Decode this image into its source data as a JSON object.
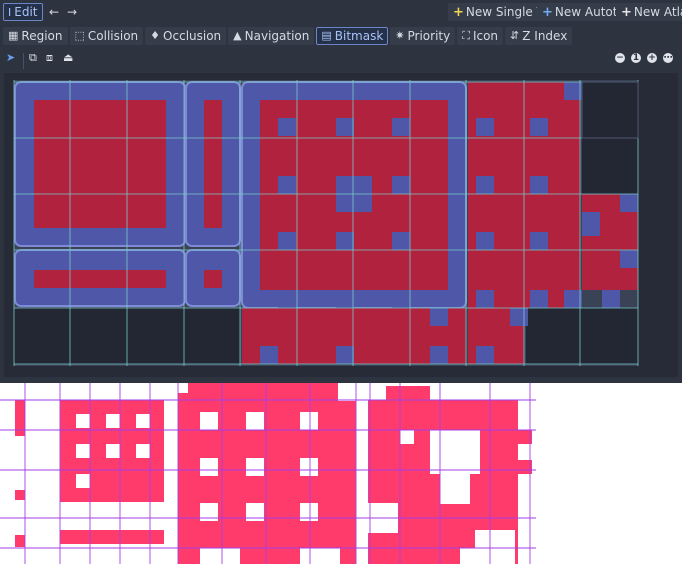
{
  "toolbar": {
    "edit_label": "Edit",
    "new_single_tile": "New Single Tile",
    "new_autotile": "New Autotile",
    "new_atlas": "New Atlas"
  },
  "modes": [
    {
      "label": "Region",
      "icon": "region-icon"
    },
    {
      "label": "Collision",
      "icon": "collision-icon"
    },
    {
      "label": "Occlusion",
      "icon": "occlusion-icon"
    },
    {
      "label": "Navigation",
      "icon": "navigation-icon"
    },
    {
      "label": "Bitmask",
      "icon": "bitmask-icon",
      "active": true
    },
    {
      "label": "Priority",
      "icon": "priority-icon"
    },
    {
      "label": "Icon",
      "icon": "icon-icon"
    },
    {
      "label": "Z Index",
      "icon": "z-index-icon"
    }
  ],
  "colors": {
    "editor_bg": "#2e3340",
    "mask_red": "#b0223e",
    "mask_blue": "#4f57a8",
    "grid_line": "#7ac9c7",
    "empty_tile": "#222733",
    "texture_pink": "#ff3b6b",
    "texture_grid": "#a63ee6",
    "accent": "#6b86c7"
  }
}
